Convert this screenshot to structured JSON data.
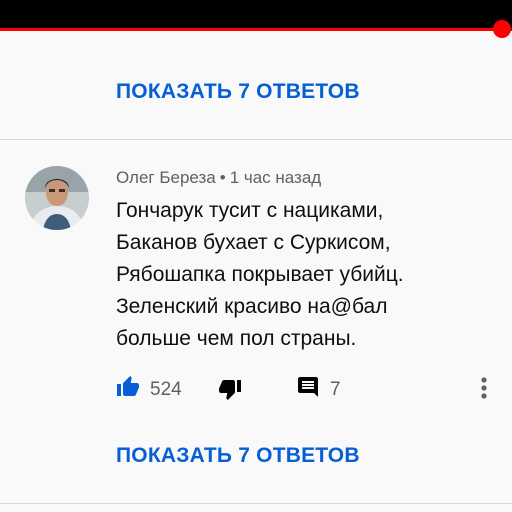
{
  "player": {
    "progress_fraction": 0.98,
    "accent_color": "#ff0000"
  },
  "replies_top": {
    "label": "ПОКАЗАТЬ 7 ОТВЕТОВ"
  },
  "comment": {
    "author": "Олег Береза",
    "separator": "•",
    "time": "1 час назад",
    "lines": [
      "Гончарук тусит с нациками,",
      "Баканов бухает с Суркисом,",
      "Рябошапка покрывает убийц.",
      "Зеленский красиво на@бал",
      "больше чем пол страны."
    ],
    "likes": "524",
    "replies_count": "7",
    "icons": [
      "thumb-up-icon",
      "thumb-down-icon",
      "comment-icon",
      "more-vert-icon"
    ]
  },
  "replies_bottom": {
    "label": "ПОКАЗАТЬ 7 ОТВЕТОВ"
  },
  "colors": {
    "link": "#065fd4",
    "meta": "#606060",
    "text": "#0f0f0f",
    "icon": "#030303"
  }
}
